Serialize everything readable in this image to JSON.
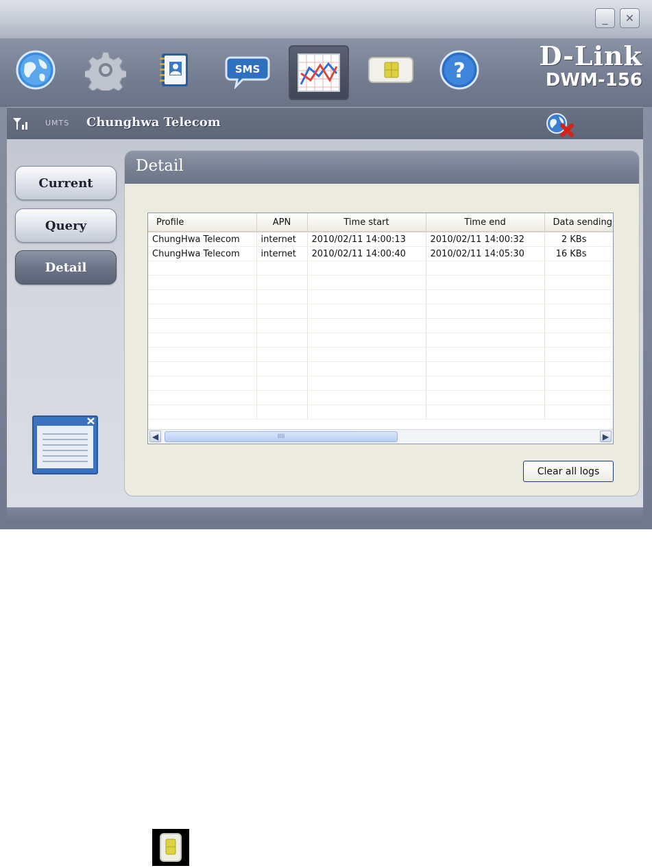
{
  "window": {
    "minimize_label": "_",
    "close_label": "✕"
  },
  "toolbar": {
    "icons": [
      "globe-icon",
      "gear-icon",
      "contacts-book-icon",
      "sms-icon",
      "statistics-chart-icon",
      "sim-card-icon",
      "help-icon"
    ],
    "sms_label": "SMS",
    "help_label": "?",
    "active": "statistics-chart-icon"
  },
  "logo": {
    "brand": "D-Link",
    "model": "DWM-156"
  },
  "status": {
    "network_type": "UMTS",
    "carrier": "Chunghwa Telecom"
  },
  "nav": {
    "items": [
      {
        "label": "Current"
      },
      {
        "label": "Query"
      },
      {
        "label": "Detail"
      }
    ],
    "active": "Detail"
  },
  "panel": {
    "title": "Detail",
    "columns": [
      "Profile",
      "APN",
      "Time start",
      "Time end",
      "Data sending"
    ],
    "rows": [
      [
        "ChungHwa Telecom",
        "internet",
        "2010/02/11 14:00:13",
        "2010/02/11 14:00:32",
        "2 KBs"
      ],
      [
        "ChungHwa Telecom",
        "internet",
        "2010/02/11 14:00:40",
        "2010/02/11 14:05:30",
        "16 KBs"
      ]
    ],
    "scroll_grip": "IIII",
    "clear_button": "Clear all logs"
  },
  "colors": {
    "chrome": "#737c90",
    "panel_bg": "#ecebdf",
    "active_nav": "#6c7488"
  }
}
